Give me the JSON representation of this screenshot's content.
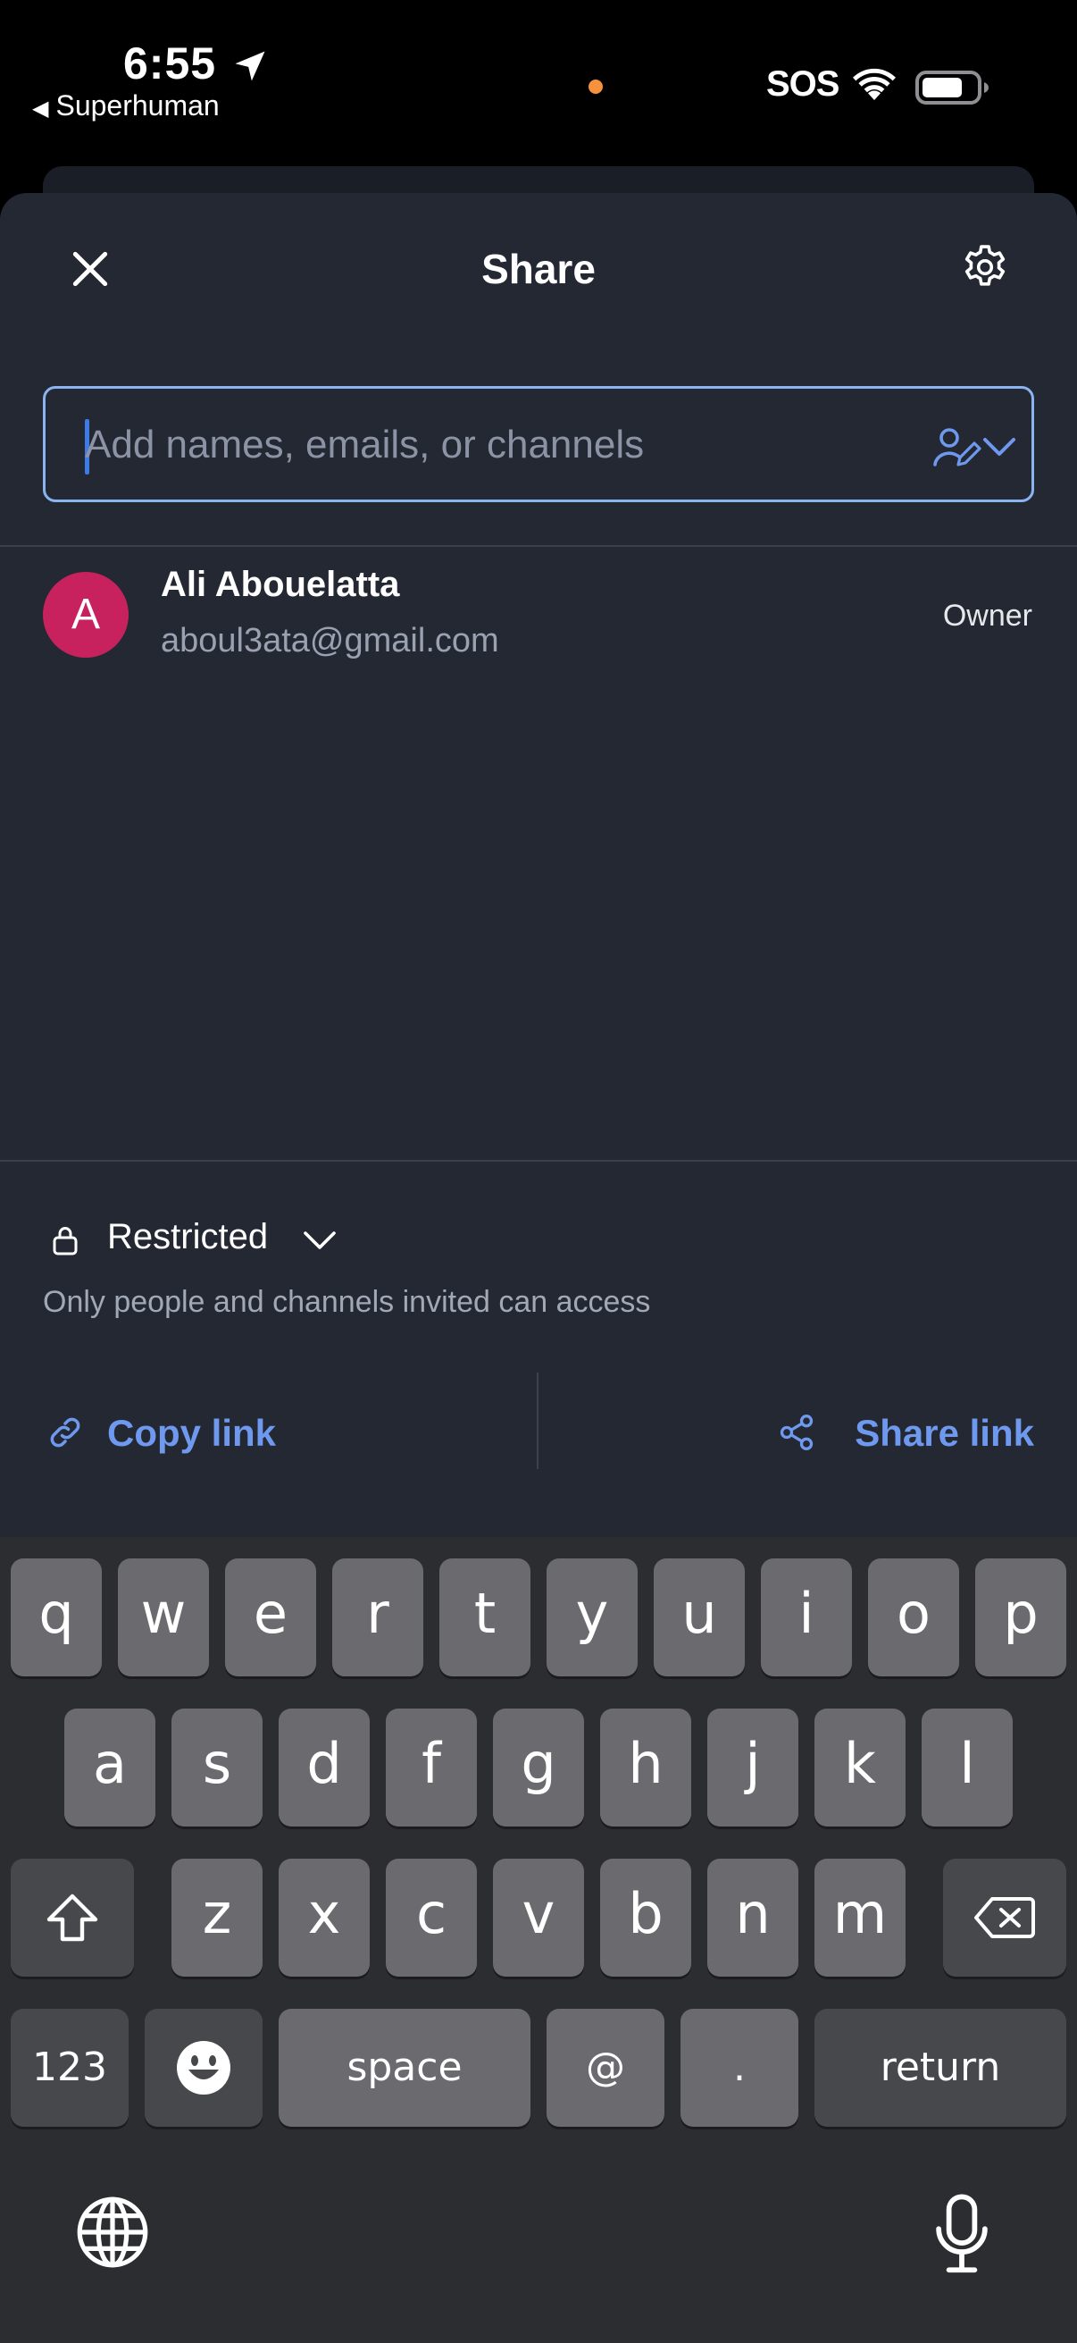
{
  "status_bar": {
    "time": "6:55",
    "back_app": "Superhuman",
    "sos": "SOS"
  },
  "sheet": {
    "title": "Share",
    "search": {
      "placeholder": "Add names, emails, or channels"
    },
    "people": [
      {
        "initial": "A",
        "name": "Ali Abouelatta",
        "email": "aboul3ata@gmail.com",
        "role": "Owner",
        "avatar_color": "#c7225e"
      }
    ],
    "access": {
      "label": "Restricted",
      "description": "Only people and channels invited can access"
    },
    "actions": {
      "copy_link": "Copy link",
      "share_link": "Share link"
    }
  },
  "colors": {
    "sheet_bg": "#232833",
    "accent": "#6f99ee",
    "input_border": "#8ab4f0"
  },
  "keyboard": {
    "row1": [
      "q",
      "w",
      "e",
      "r",
      "t",
      "y",
      "u",
      "i",
      "o",
      "p"
    ],
    "row2": [
      "a",
      "s",
      "d",
      "f",
      "g",
      "h",
      "j",
      "k",
      "l"
    ],
    "row3": [
      "z",
      "x",
      "c",
      "v",
      "b",
      "n",
      "m"
    ],
    "numbers_key": "123",
    "space_key": "space",
    "at_key": "@",
    "period_key": ".",
    "return_key": "return"
  }
}
